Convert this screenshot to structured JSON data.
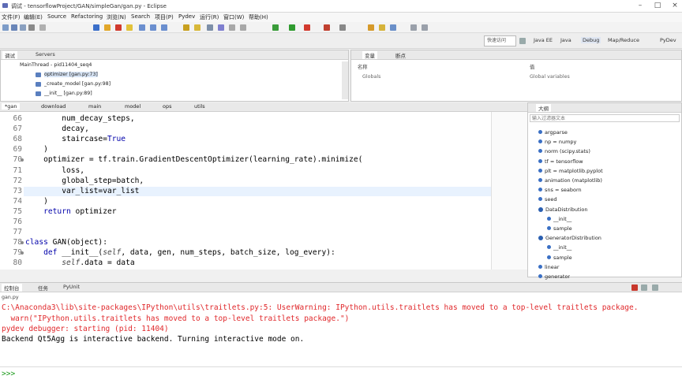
{
  "window": {
    "title": "调试 - tensorflowProject/GAN/simpleGan/gan.py - Eclipse"
  },
  "menu": [
    "文件(F)",
    "编辑(E)",
    "Source",
    "Refactoring",
    "浏览(N)",
    "Search",
    "项目(P)",
    "Pydev",
    "运行(R)",
    "窗口(W)",
    "帮助(H)"
  ],
  "toolbar": {
    "quick_access": "快速访问",
    "perspectives": [
      "Java EE",
      "Java",
      "Debug",
      "Map/Reduce",
      "PyDev"
    ]
  },
  "debug_view": {
    "tabs": [
      "调试",
      "Servers"
    ],
    "thread": "MainThread - pid11404_seq4",
    "frames": [
      "optimizer [gan.py:73]",
      "_create_model [gan.py:98]",
      "__init__ [gan.py:89]"
    ]
  },
  "variables_view": {
    "tabs": [
      "变量",
      "断点"
    ],
    "headers": [
      "名称",
      "值"
    ],
    "row": {
      "name": "Globals",
      "value": "Global variables"
    }
  },
  "editor": {
    "tabs": [
      "*gan",
      "download",
      "main",
      "model",
      "ops",
      "utils"
    ],
    "line_numbers": [
      "66",
      "67",
      "68",
      "69",
      "70",
      "71",
      "72",
      "73",
      "74",
      "75",
      "76",
      "77",
      "78",
      "79",
      "80"
    ],
    "lines": [
      "        num_decay_steps,",
      "        decay,",
      "        staircase=True",
      "    )",
      "    optimizer = tf.train.GradientDescentOptimizer(learning_rate).minimize(",
      "        loss,",
      "        global_step=batch,",
      "        var_list=var_list",
      "    )",
      "    return optimizer",
      "",
      "",
      "class GAN(object):",
      "    def __init__(self, data, gen, num_steps, batch_size, log_every):",
      "        self.data = data"
    ]
  },
  "outline": {
    "tab": "大纲",
    "filter_placeholder": "输入过滤器文本",
    "items": [
      "argparse",
      "np = numpy",
      "norm (scipy.stats)",
      "tf = tensorflow",
      "plt = matplotlib.pyplot",
      "animation (matplotlib)",
      "sns = seaborn",
      "seed",
      "DataDistribution",
      "__init__",
      "sample",
      "GeneratorDistribution",
      "__init__",
      "sample",
      "linear",
      "generator"
    ]
  },
  "console": {
    "tabs": [
      "控制台",
      "任务",
      "PyUnit"
    ],
    "name": "gan.py",
    "lines": [
      "C:\\Anaconda3\\lib\\site-packages\\IPython\\utils\\traitlets.py:5: UserWarning: IPython.utils.traitlets has moved to a top-level traitlets package.",
      "  warn(\"IPython.utils.traitlets has moved to a top-level traitlets package.\")",
      "pydev debugger: starting (pid: 11404)",
      "Backend Qt5Agg is interactive backend. Turning interactive mode on."
    ],
    "prompt": ">>>"
  },
  "colors": {
    "error": "#e0282b",
    "keyword": "#0000aa",
    "prompt": "#1a9a1a",
    "highlight": "#e8f2fe"
  }
}
